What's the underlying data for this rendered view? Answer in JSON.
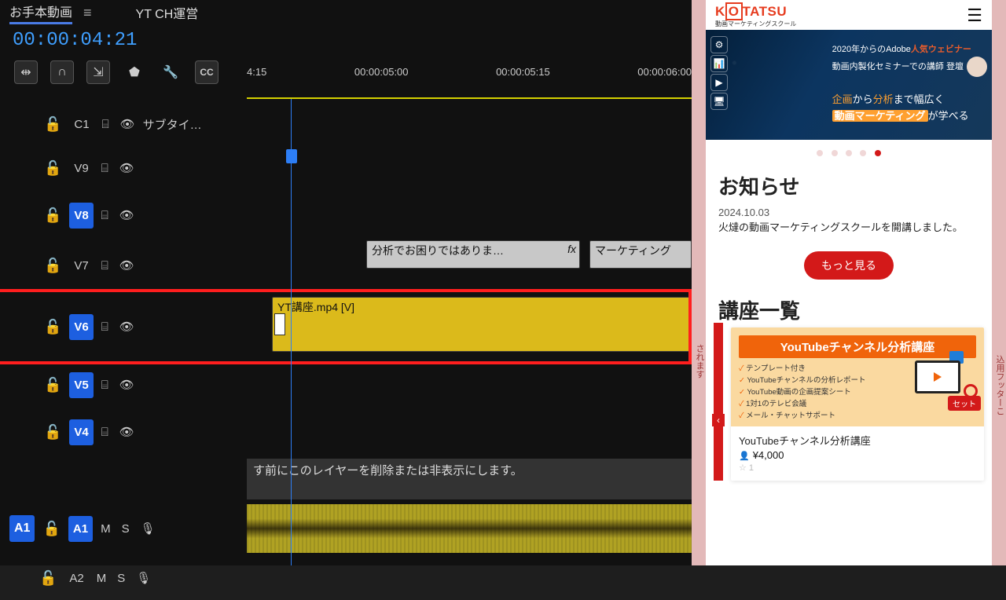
{
  "editor": {
    "sequence_name": "お手本動画",
    "bin_name": "YT CH運営",
    "timecode": "00:00:04:21",
    "ruler": {
      "t0": "4:15",
      "t1": "00:00:05:00",
      "t2": "00:00:05:15",
      "t3": "00:00:06:00"
    },
    "caption_track": {
      "id": "C1",
      "label": "サブタイ…"
    },
    "video_tracks": [
      {
        "id": "V9",
        "selected": false
      },
      {
        "id": "V8",
        "selected": true
      },
      {
        "id": "V7",
        "selected": false
      },
      {
        "id": "V6",
        "selected": true
      },
      {
        "id": "V5",
        "selected": true
      },
      {
        "id": "V4",
        "selected": true
      }
    ],
    "v7_clip_a": "分析でお困りではありま…",
    "v7_clip_a_fx": "fx",
    "v7_clip_b": "マーケティング",
    "v6_clip": "YT講座.mp4 [V]",
    "instruction_text": "す前にこのレイヤーを削除または非表示にします。",
    "audio_tracks": [
      {
        "patch": "A1",
        "id": "A1",
        "m": "M",
        "s": "S"
      },
      {
        "patch": "",
        "id": "A2",
        "m": "M",
        "s": "S"
      }
    ]
  },
  "web": {
    "logo": "KOTATSU",
    "logo_sub": "動画マーケティングスクール",
    "frame_left_text": "されます",
    "frame_right_text": "込用フッターこ",
    "hero": {
      "line1_pre": "2020年からのAdobe",
      "line1_hl": "人気ウェビナー",
      "line2": "動画内製化セミナーでの講師 登壇",
      "line3_a": "企画",
      "line3_b": "から",
      "line3_c": "分析",
      "line3_d": "まで幅広く",
      "line4_hl": "動画マーケティング",
      "line4_post": "が学べる"
    },
    "news_title": "お知らせ",
    "news_date": "2024.10.03",
    "news_body": "火燵の動画マーケティングスクールを開講しました。",
    "more_label": "もっと見る",
    "courses_title": "講座一覧",
    "course": {
      "banner_title": "YouTubeチャンネル分析講座",
      "bullets": [
        "テンプレート付き",
        "YouTubeチャンネルの分析レポート",
        "YouTube動画の企画提案シート",
        "1対1のテレビ会議",
        "メール・チャットサポート"
      ],
      "badge": "セット",
      "name": "YouTubeチャンネル分析講座",
      "price": "¥4,000",
      "star": "☆ 1"
    }
  }
}
